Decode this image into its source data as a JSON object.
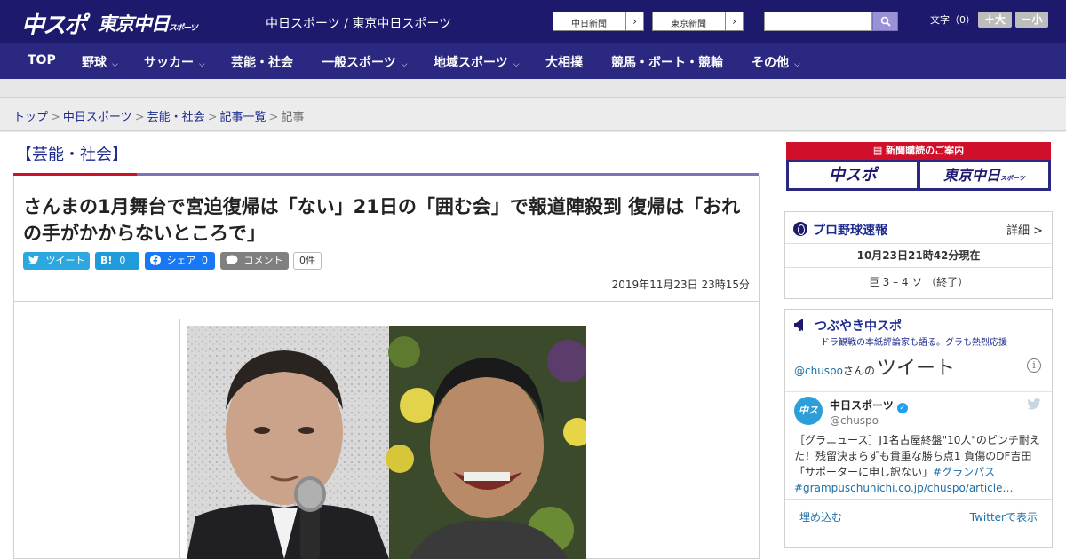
{
  "header": {
    "logo_primary": "中スポ",
    "logo_secondary": "東京中日",
    "logo_secondary_small": "スポーツ",
    "site_names": "中日スポーツ / 東京中日スポーツ",
    "external_links": [
      {
        "label": "中日新聞",
        "arrow": "›"
      },
      {
        "label": "東京新聞",
        "arrow": "›"
      }
    ],
    "search": {
      "value": "",
      "placeholder": ""
    },
    "font_size": {
      "label": "文字（0）",
      "larger": "＋大",
      "smaller": "－小"
    }
  },
  "nav": {
    "items": [
      {
        "label": "TOP",
        "has_dropdown": false
      },
      {
        "label": "野球",
        "has_dropdown": true
      },
      {
        "label": "サッカー",
        "has_dropdown": true
      },
      {
        "label": "芸能・社会",
        "has_dropdown": false
      },
      {
        "label": "一般スポーツ",
        "has_dropdown": true
      },
      {
        "label": "地域スポーツ",
        "has_dropdown": true
      },
      {
        "label": "大相撲",
        "has_dropdown": false
      },
      {
        "label": "競馬・ボート・競輪",
        "has_dropdown": false
      },
      {
        "label": "その他",
        "has_dropdown": true
      }
    ],
    "dropdown_glyph": "⌵"
  },
  "breadcrumb": {
    "items": [
      "トップ",
      "中日スポーツ",
      "芸能・社会",
      "記事一覧"
    ],
    "current": "記事",
    "separator": ">"
  },
  "article": {
    "section": "【芸能・社会】",
    "headline": "さんまの1月舞台で宮迫復帰は「ない」21日の「囲む会」で報道陣殺到 復帰は「おれの手がかからないところで」",
    "share": {
      "tweet": "ツイート",
      "hatena": "B!",
      "hatena_count": "0",
      "facebook": "シェア",
      "facebook_count": "0",
      "comment": "コメント",
      "comment_count": "0件"
    },
    "date": "2019年11月23日 23時15分"
  },
  "sidebar": {
    "subscription": {
      "title": "新聞購読のご案内",
      "buttons": [
        "中スポ",
        "東京中日"
      ],
      "button_small": "スポーツ"
    },
    "baseball": {
      "title": "プロ野球速報",
      "detail": "詳細 >",
      "as_of": "10月23日21時42分現在",
      "score": "巨 3 – 4 ソ （終了）"
    },
    "tsubuyaki": {
      "title": "つぶやき中スポ",
      "subtitle": "ドラ観戦の本紙評論家も語る。グラも熱烈応援",
      "header_handle": "@chuspo",
      "header_suffix": "さんの",
      "header_big": "ツイート",
      "info": "i",
      "tweet": {
        "avatar_text": "中スポ",
        "name": "中日スポーツ",
        "verified": "✓",
        "handle": "@chuspo",
        "text": "［グラニュース］J1名古屋終盤\"10人\"のピンチ耐えた！残留決まらずも貴重な勝ち点1 負傷のDF吉田「サポーターに申し訳ない」",
        "hashtag": "#グランパス",
        "link": "#grampuschunichi.co.jp/chuspo/article…"
      },
      "embed": "埋め込む",
      "view_on_twitter": "Twitterで表示"
    }
  },
  "colors": {
    "header_bg": "#1d1a6e",
    "nav_bg": "#2b2882",
    "link": "#1d2b8f",
    "accent_red": "#d0102a",
    "twitter": "#2da7e0",
    "hatena": "#1e9bd8",
    "facebook": "#1877f2",
    "comment": "#808080"
  }
}
